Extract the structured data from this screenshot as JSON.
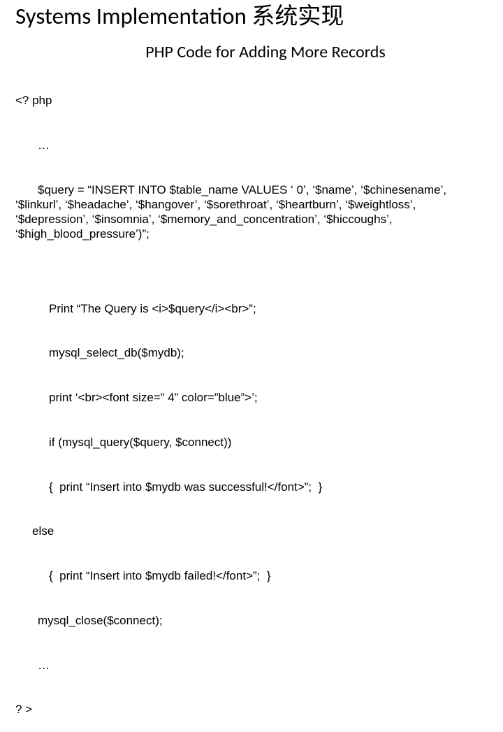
{
  "title": "Systems Implementation  系统实现",
  "subtitle": "PHP Code for Adding More Records",
  "code": {
    "l1": "<? php",
    "l2": "…",
    "l3": "$query = “INSERT INTO $table_name VALUES ‘ 0’, ‘$name’, ‘$chinesename’,           ‘$linkurl’, ‘$headache’, ‘$hangover’, ‘$sorethroat’, ‘$heartburn’, ‘$weightloss’, ‘$depression’, ‘$insomnia’, ‘$memory_and_concentration’, ‘$hiccoughs’, ‘$high_blood_pressure’)”;",
    "l4": "",
    "l5": "Print “The Query is <i>$query</i><br>”;",
    "l6": "mysql_select_db($mydb);",
    "l7": "print ‘<br><font size=” 4” color=”blue”>’;",
    "l8": "if (mysql_query($query, $connect))",
    "l9": "{  print “Insert into $mydb was successful!</font>”;  }",
    "l10": "else",
    "l11": "{  print “Insert into $mydb failed!</font>”;  }",
    "l12": "mysql_close($connect);",
    "l13": "…",
    "l14": "? >"
  }
}
